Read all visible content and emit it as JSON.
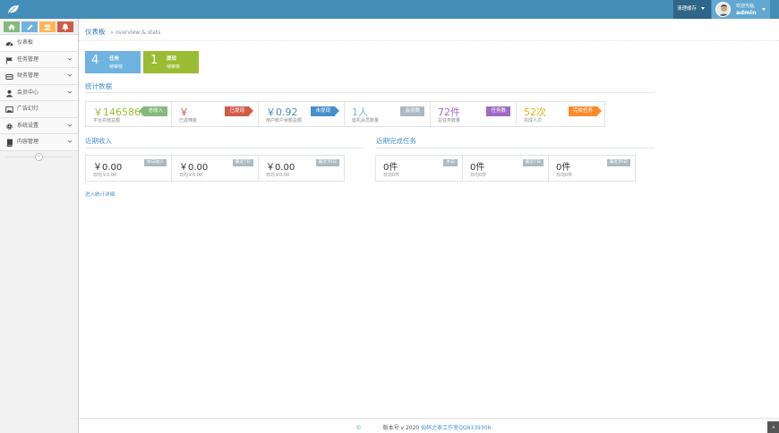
{
  "header": {
    "clear_cache": "清理缓存",
    "welcome": "欢迎光临,",
    "username": "admin"
  },
  "sidebar": {
    "items": [
      {
        "label": "仪表板",
        "icon": "dashboard-icon"
      },
      {
        "label": "任务管理",
        "icon": "flag-icon"
      },
      {
        "label": "财务管理",
        "icon": "wallet-icon"
      },
      {
        "label": "会员中心",
        "icon": "user-icon"
      },
      {
        "label": "广告幻灯",
        "icon": "picture-icon"
      },
      {
        "label": "系统设置",
        "icon": "gear-icon"
      },
      {
        "label": "内容管理",
        "icon": "book-icon"
      }
    ],
    "collapse": "«"
  },
  "page": {
    "title": "仪表板",
    "subtitle": "» overview & stats"
  },
  "infoboxes": [
    {
      "number": "4",
      "line1": "任务",
      "line2": "待审核",
      "color": "#6fb3e0"
    },
    {
      "number": "1",
      "line1": "提现",
      "line2": "待审核",
      "color": "#9abc32"
    }
  ],
  "stats_title": "统计数据",
  "stats": [
    {
      "value": "￥146586.0",
      "label": "平台充值总额",
      "badge": "总收入",
      "value_color": "#9abc32",
      "badge_color": "#87b87f"
    },
    {
      "value": "￥",
      "label": "已返佣金",
      "badge": "已提现",
      "value_color": "#d15b47",
      "badge_color": "#d15b47"
    },
    {
      "value": "￥0.92",
      "label": "用户账户余额总额",
      "badge": "未提现",
      "value_color": "#478fca",
      "badge_color": "#478fca"
    },
    {
      "value": "1人",
      "label": "座机会员数量",
      "badge": "会员数",
      "value_color": "#6fb3e0",
      "badge_color": "#abbac3"
    },
    {
      "value": "72件",
      "label": "总任务数量",
      "badge": "任务数",
      "value_color": "#a069c3",
      "badge_color": "#a069c3"
    },
    {
      "value": "52次",
      "label": "完成人次",
      "badge": "完成任务",
      "value_color": "#e8b110",
      "badge_color": "#ff892a"
    }
  ],
  "income": {
    "title": "近期收入",
    "boxes": [
      {
        "value": "￥0.00",
        "sub": "日均￥0.00",
        "tag": "本日收入"
      },
      {
        "value": "￥0.00",
        "sub": "日均￥0.00",
        "tag": "最近7日"
      },
      {
        "value": "￥0.00",
        "sub": "日均￥0.00",
        "tag": "最近30日"
      }
    ]
  },
  "tasks": {
    "title": "近期完成任务",
    "boxes": [
      {
        "value": "0件",
        "sub": "日均0件",
        "tag": "本日"
      },
      {
        "value": "0件",
        "sub": "日均0件",
        "tag": "最近7日"
      },
      {
        "value": "0件",
        "sub": "日均0件",
        "tag": "最近30日"
      }
    ]
  },
  "link_all": "进入统计详细",
  "footer": {
    "copyright": "©",
    "version": "版本号 v 2020",
    "studio": "仙码之家工作室QQ8139306"
  },
  "scroll_top": "«"
}
